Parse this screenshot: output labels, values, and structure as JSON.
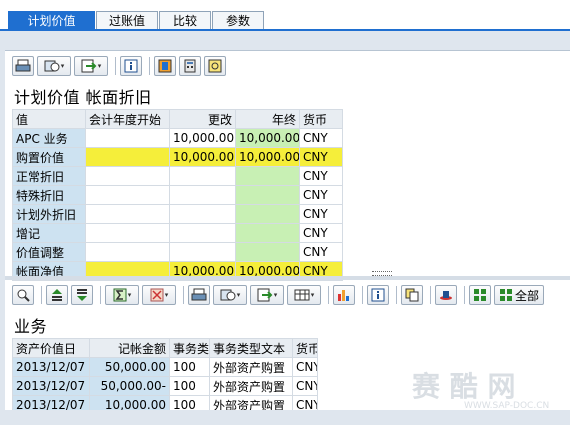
{
  "tabs": [
    {
      "label": "计划价值"
    },
    {
      "label": "过账值"
    },
    {
      "label": "比较"
    },
    {
      "label": "参数"
    }
  ],
  "upper": {
    "title": "计划价值 帐面折旧",
    "columns": [
      "值",
      "会计年度开始",
      "更改",
      "年终",
      "货币"
    ],
    "rows": [
      {
        "label": "APC 业务",
        "start": "",
        "change": "10,000.00",
        "year_end": "10,000.00",
        "currency": "CNY"
      },
      {
        "label": "购置价值",
        "start": "",
        "change": "10,000.00",
        "year_end": "10,000.00",
        "currency": "CNY"
      },
      {
        "label": "正常折旧",
        "start": "",
        "change": "",
        "year_end": "",
        "currency": "CNY"
      },
      {
        "label": "特殊折旧",
        "start": "",
        "change": "",
        "year_end": "",
        "currency": "CNY"
      },
      {
        "label": "计划外折旧",
        "start": "",
        "change": "",
        "year_end": "",
        "currency": "CNY"
      },
      {
        "label": "增记",
        "start": "",
        "change": "",
        "year_end": "",
        "currency": "CNY"
      },
      {
        "label": "价值调整",
        "start": "",
        "change": "",
        "year_end": "",
        "currency": "CNY"
      },
      {
        "label": "帐面净值",
        "start": "",
        "change": "10,000.00",
        "year_end": "10,000.00",
        "currency": "CNY"
      }
    ]
  },
  "lower": {
    "title": "业务",
    "all_label": "全部",
    "columns": [
      "资产价值日",
      "记帐金额",
      "事务类",
      "事务类型文本",
      "货币"
    ],
    "rows": [
      {
        "date": "2013/12/07",
        "amount": "50,000.00",
        "type": "100",
        "type_text": "外部资产购置",
        "currency": "CNY"
      },
      {
        "date": "2013/12/07",
        "amount": "50,000.00-",
        "type": "100",
        "type_text": "外部资产购置",
        "currency": "CNY"
      },
      {
        "date": "2013/12/07",
        "amount": "10,000.00",
        "type": "100",
        "type_text": "外部资产购置",
        "currency": "CNY"
      }
    ]
  },
  "colors": {
    "accent": "#1f6fd0",
    "yellow": "#f5ee3a",
    "green": "#c8f0b4",
    "row_header": "#cde2f1"
  },
  "watermark": {
    "text": "赛 酷 网",
    "sub": "WWW.SAP-DOC.CN"
  }
}
